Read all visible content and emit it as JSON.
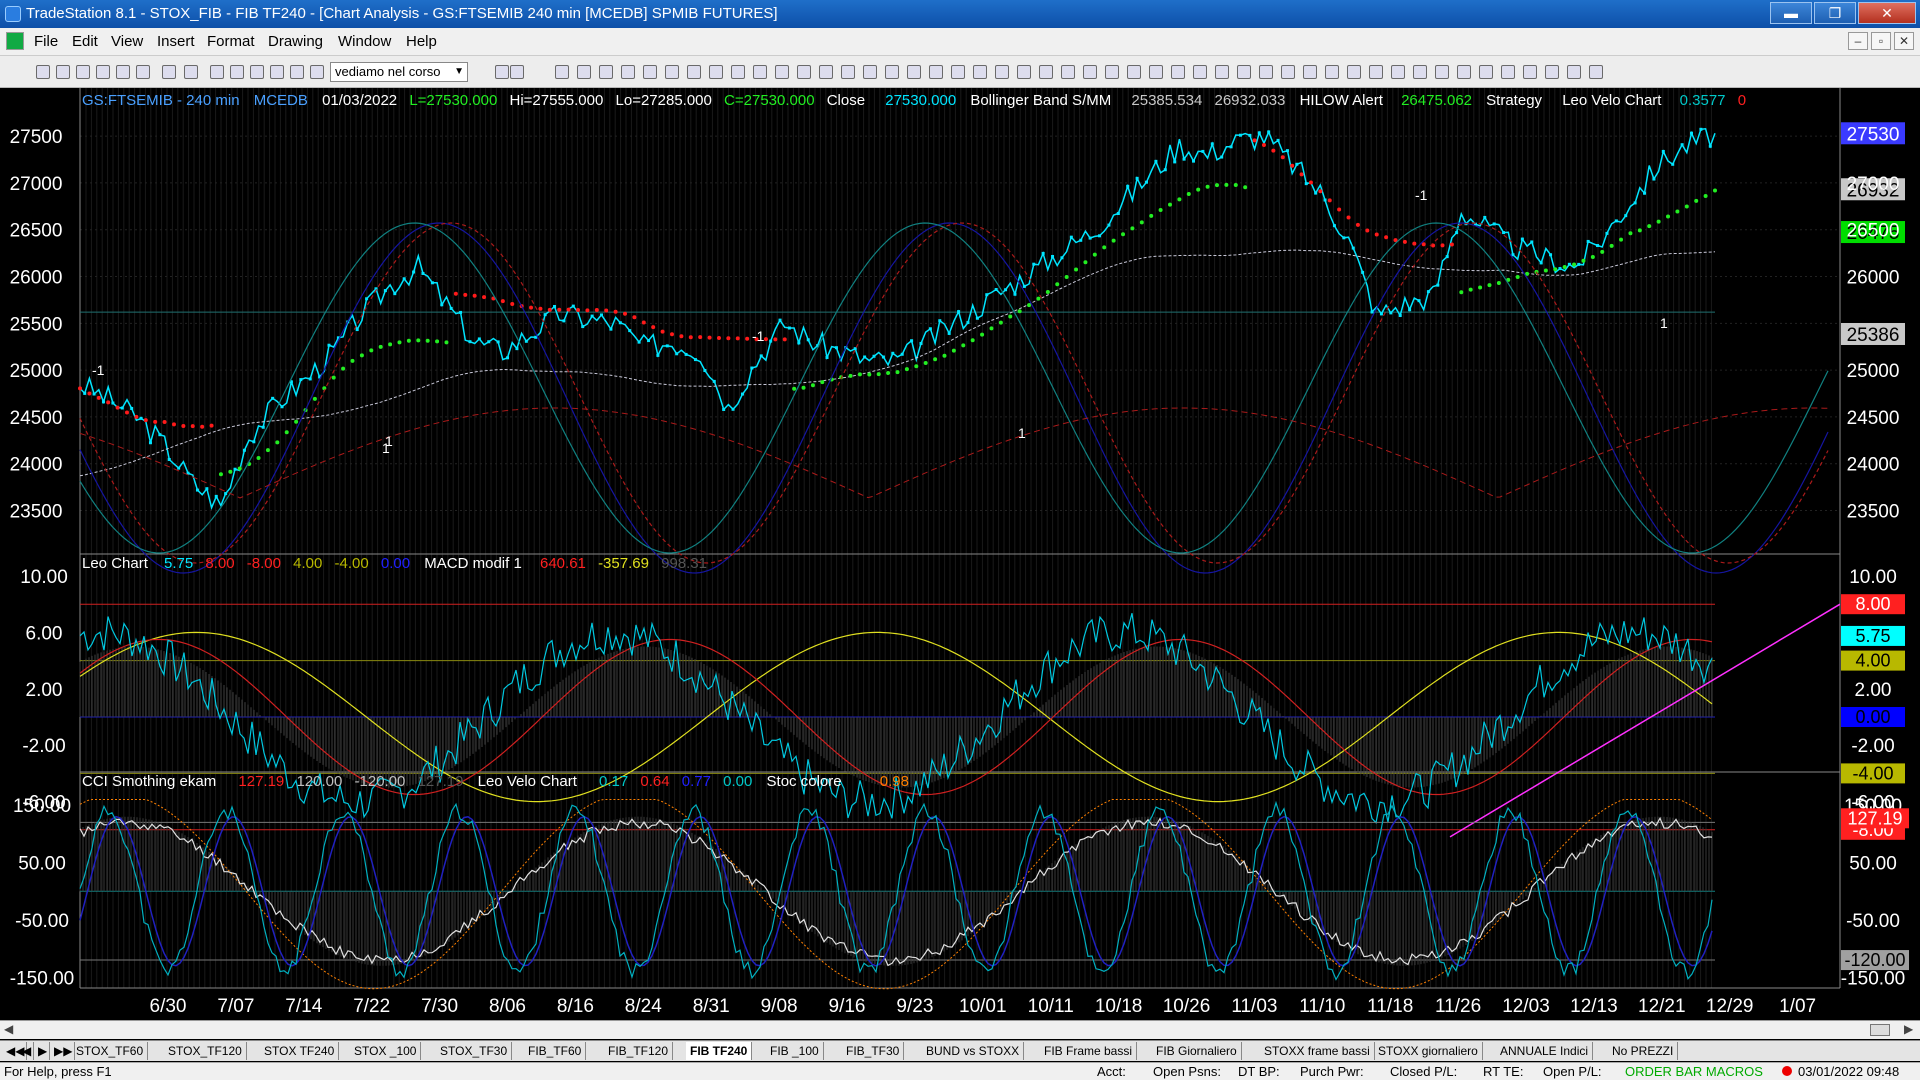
{
  "window": {
    "title": "TradeStation 8.1 - STOX_FIB - FIB TF240 - [Chart Analysis - GS:FTSEMIB  240 min  [MCEDB] SPMIB FUTURES]",
    "min": "▬",
    "restore": "❐",
    "close": "✕"
  },
  "menu": [
    "File",
    "Edit",
    "View",
    "Insert",
    "Format",
    "Drawing",
    "Window",
    "Help"
  ],
  "mdi_buttons": [
    "–",
    "▫",
    "✕"
  ],
  "toolbar": {
    "combo_value": "vediamo nel corso"
  },
  "header": {
    "symbol": "GS:FTSEMIB - 240 min",
    "feed": "MCEDB",
    "date": "01/03/2022",
    "L": "L=27530.000",
    "H": "Hi=27555.000",
    "Lo": "Lo=27285.000",
    "C": "C=27530.000",
    "close_label": "Close",
    "close_val": "27530.000",
    "bb_label": "Bollinger Band S/MM",
    "bb_v1": "25385.534",
    "bb_v2": "26932.033",
    "hilow_label": "HILOW Alert",
    "hilow_val": "26475.062",
    "strategy_label": "Strategy",
    "velo_label": "Leo Velo Chart",
    "velo_v1": "0.3577",
    "velo_v2": "0"
  },
  "panel2": {
    "label": "Leo Chart",
    "v1": "5.75",
    "v2": "8.00",
    "v3": "-8.00",
    "v4": "4.00",
    "v5": "-4.00",
    "v6": "0.00",
    "macd_label": "MACD modif 1",
    "m1": "640.61",
    "m2": "-357.69",
    "m3": "998.31"
  },
  "panel3": {
    "label": "CCI Smothing ekam",
    "v1": "127.19",
    "v2": "120.00",
    "v3": "-120.00",
    "v4": "127.19",
    "velo_label": "Leo Velo Chart",
    "v5": "0.17",
    "v6": "0.64",
    "v7": "0.77",
    "v8": "0.00",
    "stoc_label": "Stoc colore",
    "v9": "0.98"
  },
  "price_axis": [
    "27500",
    "27000",
    "26500",
    "26000",
    "25500",
    "25000",
    "24500",
    "24000",
    "23500"
  ],
  "price_tags": [
    {
      "text": "27530",
      "bg": "#3a3aff",
      "fg": "#ffffff"
    },
    {
      "text": "26932",
      "bg": "#c8c8c8",
      "fg": "#000000"
    },
    {
      "text": "26475",
      "bg": "#00dd00",
      "fg": "#000000"
    },
    {
      "text": "25386",
      "bg": "#c8c8c8",
      "fg": "#000000"
    }
  ],
  "p2_axis": [
    "10.00",
    "6.00",
    "2.00",
    "-2.00",
    "-6.00"
  ],
  "p2_tags": [
    {
      "text": "8.00",
      "bg": "#ff2020",
      "fg": "#ffffff"
    },
    {
      "text": "5.75",
      "bg": "#00ffff",
      "fg": "#000000"
    },
    {
      "text": "4.00",
      "bg": "#b8b800",
      "fg": "#000000"
    },
    {
      "text": "0.00",
      "bg": "#0000ff",
      "fg": "#000000"
    },
    {
      "text": "-4.00",
      "bg": "#b8b800",
      "fg": "#000000"
    },
    {
      "text": "-8.00",
      "bg": "#ff2020",
      "fg": "#ffffff"
    }
  ],
  "p3_axis": [
    "150.00",
    "50.00",
    "-50.00",
    "-150.00"
  ],
  "p3_tags": [
    {
      "text": "127.19",
      "bg": "#ff2020",
      "fg": "#ffffff"
    },
    {
      "text": "-120.00",
      "bg": "#a0a0a0",
      "fg": "#000000"
    }
  ],
  "p3_extra_labels": [
    "150.00",
    "-150.00"
  ],
  "date_axis": [
    "6/30",
    "7/07",
    "7/14",
    "7/22",
    "7/30",
    "8/06",
    "8/16",
    "8/24",
    "8/31",
    "9/08",
    "9/16",
    "9/23",
    "10/01",
    "10/11",
    "10/18",
    "10/26",
    "11/03",
    "11/10",
    "11/18",
    "11/26",
    "12/03",
    "12/13",
    "12/21",
    "12/29",
    "1/07"
  ],
  "chart_markers": [
    "-1",
    "1",
    "-1",
    "1",
    "-1",
    "1",
    "1"
  ],
  "tabs": [
    "STOX_TF60",
    "STOX_TF120",
    "STOX TF240",
    "STOX _100",
    "STOX_TF30",
    "FIB_TF60",
    "FIB_TF120",
    "FIB TF240",
    "FIB _100",
    "FIB_TF30",
    "BUND vs STOXX",
    "FIB Frame bassi",
    "FIB Giornaliero",
    "STOXX frame bassi",
    "STOXX giornaliero",
    "ANNUALE Indici",
    "No PREZZI"
  ],
  "active_tab": "FIB TF240",
  "status": {
    "help": "For Help, press F1",
    "acct": "Acct:",
    "open_psns": "Open Psns:",
    "dt_bp": "DT BP:",
    "purch_pwr": "Purch Pwr:",
    "closed_pl": "Closed P/L:",
    "rt_te": "RT TE:",
    "open_pl": "Open P/L:",
    "order_bar": "ORDER BAR  MACROS",
    "datetime": "03/01/2022 09:48"
  },
  "colors": {
    "cyan": "#00e5ff",
    "red": "#ff1a1a",
    "green": "#22ee22",
    "blue": "#2020c0",
    "yellow": "#e0e020",
    "magenta": "#ff30ff"
  },
  "icons": [
    "app-icon",
    "new-icon",
    "open-icon",
    "save-icon",
    "print-icon",
    "zoom-in-icon",
    "zoom-out-icon",
    "cursor-icon",
    "trendline-icon",
    "text-icon"
  ],
  "chart_data": {
    "type": "line",
    "price_close": [
      24850,
      24700,
      24500,
      24200,
      23800,
      23550,
      24300,
      24650,
      24900,
      25200,
      25600,
      25900,
      26100,
      25700,
      25300,
      25200,
      25400,
      25600,
      25550,
      25500,
      25250,
      25300,
      25200,
      24600,
      25100,
      25500,
      25300,
      25200,
      25100,
      25100,
      25300,
      25500,
      25700,
      25900,
      26100,
      26300,
      26500,
      26800,
      27100,
      27400,
      27300,
      27450,
      27500,
      27200,
      26900,
      26400,
      25600,
      25700,
      25800,
      26700,
      26500,
      26300,
      26200,
      26100,
      26400,
      26800,
      27200,
      27400,
      27530
    ],
    "ylim": [
      23100,
      27800
    ]
  }
}
